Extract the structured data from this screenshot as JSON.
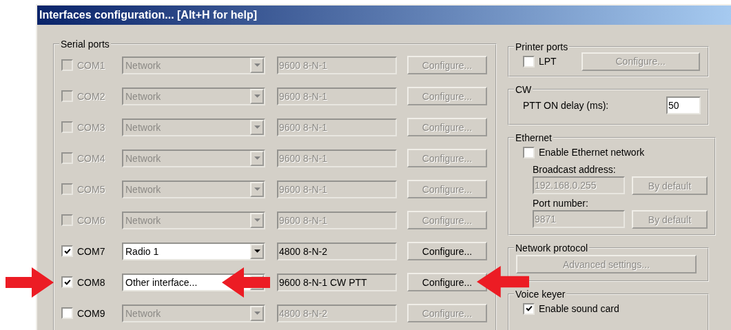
{
  "window": {
    "title": "Interfaces configuration... [Alt+H for help]"
  },
  "serial_ports": {
    "title": "Serial ports",
    "rows": [
      {
        "port": "COM1",
        "checked": false,
        "disabled": true,
        "device": "Network",
        "settings": "9600 8-N-1",
        "button": "Configure..."
      },
      {
        "port": "COM2",
        "checked": false,
        "disabled": true,
        "device": "Network",
        "settings": "9600 8-N-1",
        "button": "Configure..."
      },
      {
        "port": "COM3",
        "checked": false,
        "disabled": true,
        "device": "Network",
        "settings": "9600 8-N-1",
        "button": "Configure..."
      },
      {
        "port": "COM4",
        "checked": false,
        "disabled": true,
        "device": "Network",
        "settings": "9600 8-N-1",
        "button": "Configure..."
      },
      {
        "port": "COM5",
        "checked": false,
        "disabled": true,
        "device": "Network",
        "settings": "9600 8-N-1",
        "button": "Configure..."
      },
      {
        "port": "COM6",
        "checked": false,
        "disabled": true,
        "device": "Network",
        "settings": "9600 8-N-1",
        "button": "Configure..."
      },
      {
        "port": "COM7",
        "checked": true,
        "disabled": false,
        "device": "Radio 1",
        "settings": "4800 8-N-2",
        "button": "Configure..."
      },
      {
        "port": "COM8",
        "checked": true,
        "disabled": false,
        "device": "Other interface...",
        "settings": "9600 8-N-1 CW PTT",
        "button": "Configure..."
      },
      {
        "port": "COM9",
        "checked": false,
        "disabled": false,
        "device": "Network",
        "settings": "4800 8-N-2",
        "button": "Configure..."
      }
    ]
  },
  "printer_ports": {
    "title": "Printer ports",
    "label": "LPT",
    "checked": false,
    "button": "Configure...",
    "button_disabled": true
  },
  "cw": {
    "title": "CW",
    "label": "PTT ON delay (ms):",
    "value": "50"
  },
  "ethernet": {
    "title": "Ethernet",
    "label": "Enable Ethernet network",
    "checked": false,
    "broadcast_label": "Broadcast address:",
    "broadcast_value": "192.168.0.255",
    "broadcast_button": "By default",
    "port_label": "Port number:",
    "port_value": "9871",
    "port_button": "By default"
  },
  "network_protocol": {
    "title": "Network protocol",
    "button": "Advanced settings...",
    "button_disabled": true
  },
  "voice_keyer": {
    "title": "Voice keyer",
    "label": "Enable sound card",
    "checked": true
  },
  "annotations": [
    {
      "kind": "right_arrow"
    },
    {
      "kind": "left_arrow"
    },
    {
      "kind": "left_arrow"
    }
  ]
}
